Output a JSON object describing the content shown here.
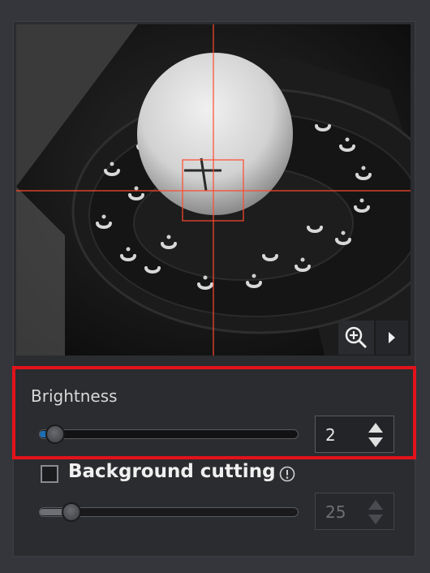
{
  "brightness": {
    "label": "Brightness",
    "value": "2",
    "slider_fraction": 0.05
  },
  "background_cutting": {
    "label": "Background cutting",
    "checked": false,
    "value": "25",
    "slider_fraction": 0.12,
    "enabled": false
  },
  "viewport": {
    "zoom_icon": "zoom-in-icon",
    "play_icon": "play-icon"
  },
  "colors": {
    "crosshair": "#ff4a2e",
    "highlight": "#e3121b",
    "slider_fill": "#1f6fb5"
  }
}
